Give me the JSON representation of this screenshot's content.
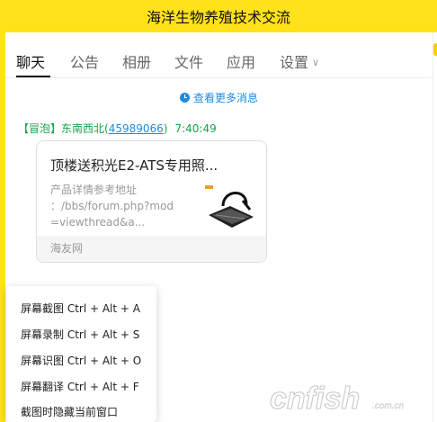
{
  "window": {
    "title": "海洋生物养殖技术交流"
  },
  "tabs": [
    {
      "label": "聊天",
      "active": true
    },
    {
      "label": "公告"
    },
    {
      "label": "相册"
    },
    {
      "label": "文件"
    },
    {
      "label": "应用"
    },
    {
      "label": "设置"
    }
  ],
  "chat": {
    "more_messages": "查看更多消息",
    "message": {
      "badge": "【冒泡】",
      "sender_name": "东南西北(",
      "qq_number": "45989066",
      "sender_close": ")",
      "time": "7:40:49",
      "card": {
        "title": "顶楼送积光E2-ATS专用照...",
        "description": "产品详情参考地址\n：/bbs/forum.php?mod\n=viewthread&a...",
        "source": "海友网"
      }
    }
  },
  "context_menu": {
    "items": [
      {
        "label": "屏幕截图 Ctrl + Alt + A"
      },
      {
        "label": "屏幕录制 Ctrl + Alt + S"
      },
      {
        "label": "屏幕识图 Ctrl + Alt + O"
      },
      {
        "label": "屏幕翻译 Ctrl + Alt + F"
      },
      {
        "label": "截图时隐藏当前窗口"
      }
    ]
  },
  "watermark": {
    "text": "cnfish",
    "suffix": ".com.cn"
  },
  "colors": {
    "titlebar": "#ffe21a",
    "link_blue": "#1f8be0",
    "sender_green": "#17a34a"
  }
}
